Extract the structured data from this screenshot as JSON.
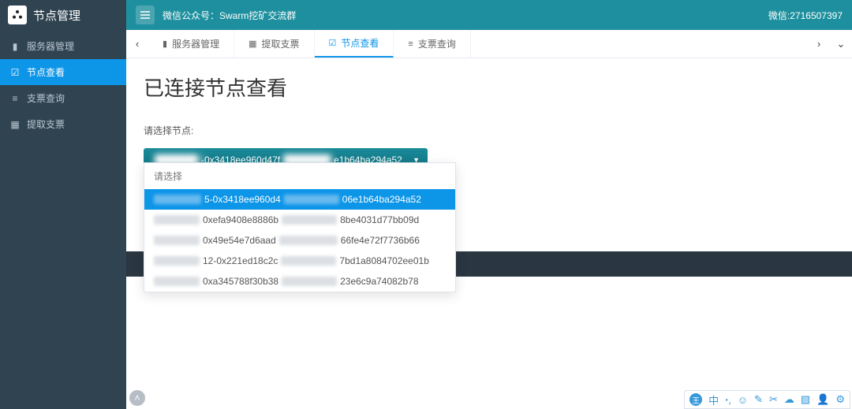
{
  "brand": {
    "title": "节点管理"
  },
  "sidebar": {
    "items": [
      {
        "icon": "▮",
        "label": "服务器管理"
      },
      {
        "icon": "☑",
        "label": "节点查看"
      },
      {
        "icon": "≡",
        "label": "支票查询"
      },
      {
        "icon": "▦",
        "label": "提取支票"
      }
    ]
  },
  "topbar": {
    "left_text": "微信公众号：Swarm挖矿交流群",
    "right_text": "微信:2716507397"
  },
  "tabs": [
    {
      "icon": "▮",
      "label": "服务器管理"
    },
    {
      "icon": "▦",
      "label": "提取支票"
    },
    {
      "icon": "☑",
      "label": "节点查看"
    },
    {
      "icon": "≡",
      "label": "支票查询"
    }
  ],
  "page": {
    "title": "已连接节点查看",
    "select_label": "请选择节点:"
  },
  "dropdown": {
    "header": "请选择",
    "current_mid1": "-0x3418ee960d47f",
    "current_mid2": "e1b64ba294a52",
    "options": [
      {
        "prefix_w": 60,
        "mid1": "5-0x3418ee960d4",
        "gap_w": 70,
        "mid2": "06e1b64ba294a52"
      },
      {
        "prefix_w": 58,
        "mid1": "0xefa9408e8886b",
        "gap_w": 70,
        "mid2": "8be4031d77bb09d"
      },
      {
        "prefix_w": 58,
        "mid1": "0x49e54e7d6aad",
        "gap_w": 74,
        "mid2": "66fe4e72f7736b66"
      },
      {
        "prefix_w": 58,
        "mid1": "12-0x221ed18c2c",
        "gap_w": 70,
        "mid2": "7bd1a8084702ee01b"
      },
      {
        "prefix_w": 58,
        "mid1": "0xa345788f30b38",
        "gap_w": 70,
        "mid2": "23e6c9a74082b78"
      }
    ]
  },
  "bottom_icons": [
    "王",
    "中",
    "ꞏ,",
    "☺",
    "✎",
    "✂",
    "☁",
    "▧",
    "👤",
    "⚙"
  ]
}
